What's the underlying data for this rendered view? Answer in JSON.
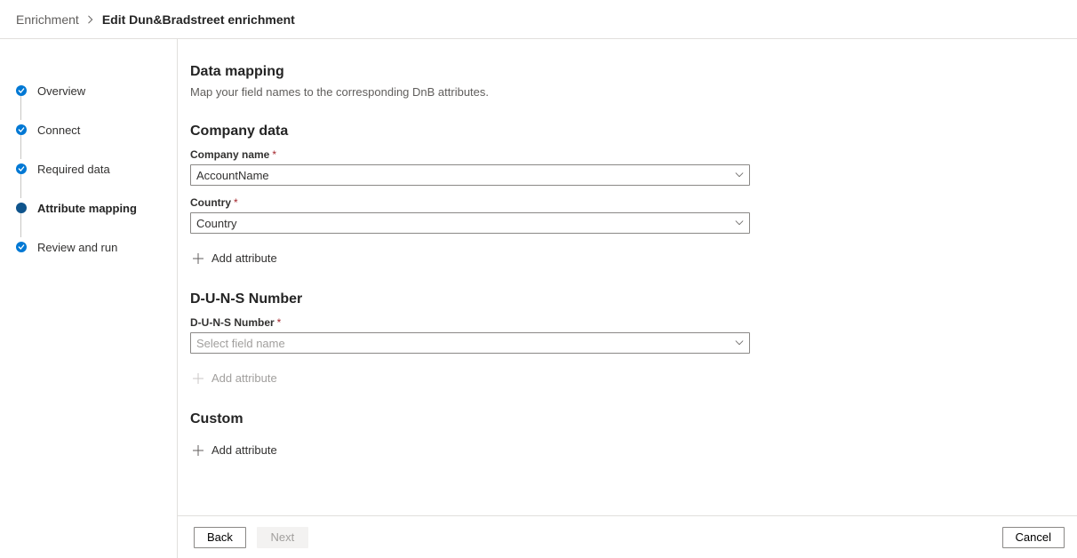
{
  "breadcrumb": {
    "root": "Enrichment",
    "current": "Edit Dun&Bradstreet enrichment"
  },
  "steps": [
    {
      "label": "Overview",
      "state": "completed"
    },
    {
      "label": "Connect",
      "state": "completed"
    },
    {
      "label": "Required data",
      "state": "completed"
    },
    {
      "label": "Attribute mapping",
      "state": "current"
    },
    {
      "label": "Review and run",
      "state": "completed"
    }
  ],
  "page": {
    "title": "Data mapping",
    "description": "Map your field names to the corresponding DnB attributes."
  },
  "sections": {
    "company": {
      "title": "Company data",
      "fields": {
        "name": {
          "label": "Company name",
          "required": true,
          "value": "AccountName"
        },
        "country": {
          "label": "Country",
          "required": true,
          "value": "Country"
        }
      },
      "add_label": "Add attribute",
      "add_enabled": true
    },
    "duns": {
      "title": "D-U-N-S Number",
      "fields": {
        "number": {
          "label": "D-U-N-S Number",
          "required": true,
          "placeholder": "Select field name",
          "value": ""
        }
      },
      "add_label": "Add attribute",
      "add_enabled": false
    },
    "custom": {
      "title": "Custom",
      "add_label": "Add attribute",
      "add_enabled": true
    }
  },
  "footer": {
    "back": "Back",
    "next": "Next",
    "cancel": "Cancel",
    "next_enabled": false
  }
}
